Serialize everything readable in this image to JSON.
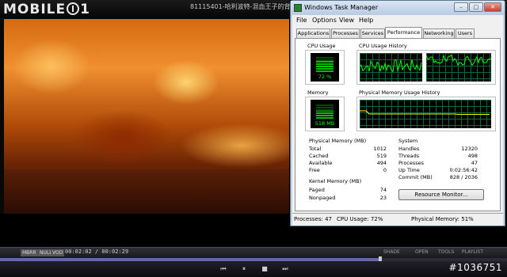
{
  "player": {
    "brand_prefix": "MOBILE",
    "brand_suffix": "1",
    "title": "81115401-哈利波特-混血王子的背叛",
    "time_display": "00:02:02 / 00:02:29",
    "badges": [
      "MBRR",
      "NULL",
      "VOD"
    ],
    "controls": [
      "SHADE",
      "OPEN",
      "TOOLS",
      "PLAYLIST"
    ],
    "transport": [
      "prev-icon",
      "pause-icon",
      "stop-icon",
      "next-icon"
    ],
    "progress": 0.75,
    "watermark": "#1036751"
  },
  "task_manager": {
    "title": "Windows Task Manager",
    "menus": [
      "File",
      "Options",
      "View",
      "Help"
    ],
    "tabs": [
      "Applications",
      "Processes",
      "Services",
      "Performance",
      "Networking",
      "Users"
    ],
    "active_tab": "Performance",
    "cpu_usage_label": "CPU Usage",
    "cpu_usage_value": "72 %",
    "cpu_usage_fraction": 0.72,
    "cpu_history_label": "CPU Usage History",
    "memory_label": "Memory",
    "memory_value": "518 MB",
    "memory_fraction": 0.51,
    "memory_history_label": "Physical Memory Usage History",
    "physical_memory": {
      "heading": "Physical Memory (MB)",
      "rows": [
        {
          "k": "Total",
          "v": "1012"
        },
        {
          "k": "Cached",
          "v": "519"
        },
        {
          "k": "Available",
          "v": "494"
        },
        {
          "k": "Free",
          "v": "0"
        }
      ]
    },
    "kernel_memory": {
      "heading": "Kernel Memory (MB)",
      "rows": [
        {
          "k": "Paged",
          "v": "74"
        },
        {
          "k": "Nonpaged",
          "v": "23"
        }
      ]
    },
    "system": {
      "heading": "System",
      "rows": [
        {
          "k": "Handles",
          "v": "12320"
        },
        {
          "k": "Threads",
          "v": "498"
        },
        {
          "k": "Processes",
          "v": "47"
        },
        {
          "k": "Up Time",
          "v": "0:02:56:42"
        },
        {
          "k": "Commit (MB)",
          "v": "828 / 2036"
        }
      ]
    },
    "resource_monitor_button": "Resource Monitor...",
    "status": {
      "processes": "Processes: 47",
      "cpu": "CPU Usage: 72%",
      "memory": "Physical Memory: 51%"
    },
    "colors": {
      "graph_line": "#00ff00",
      "graph_grid": "#0a6b3a",
      "memory_line": "#ffff00"
    }
  }
}
